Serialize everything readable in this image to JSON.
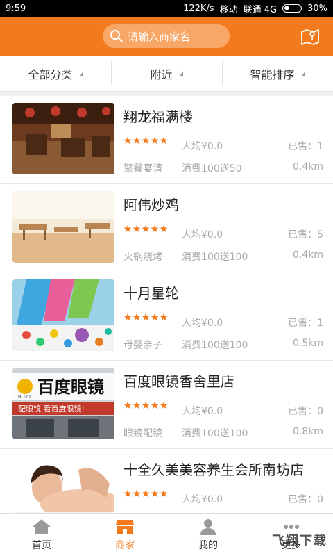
{
  "status": {
    "time": "9:59",
    "network": "122K/s",
    "carrier1": "移动",
    "carrier2": "联通 4G",
    "battery": "30%"
  },
  "search": {
    "placeholder": "请输入商家名"
  },
  "filters": [
    {
      "label": "全部分类"
    },
    {
      "label": "附近"
    },
    {
      "label": "智能排序"
    }
  ],
  "shops": [
    {
      "name": "翔龙福满楼",
      "stars": 5,
      "avg": "人均¥0.0",
      "sold": "已售：1",
      "category": "聚餐宴请",
      "promo": "消费100送50",
      "distance": "0.4km"
    },
    {
      "name": "阿伟炒鸡",
      "stars": 5,
      "avg": "人均¥0.0",
      "sold": "已售：5",
      "category": "火锅烧烤",
      "promo": "消费100送100",
      "distance": "0.4km"
    },
    {
      "name": "十月星轮",
      "stars": 5,
      "avg": "人均¥0.0",
      "sold": "已售：1",
      "category": "母婴亲子",
      "promo": "消费100送100",
      "distance": "0.5km"
    },
    {
      "name": "百度眼镜香舍里店",
      "stars": 5,
      "avg": "人均¥0.0",
      "sold": "已售：0",
      "category": "眼镜配镜",
      "promo": "消费100送100",
      "distance": "0.8km"
    },
    {
      "name": "十全久美美容养生会所南坊店",
      "stars": 5,
      "avg": "人均¥0.0",
      "sold": "已售：0",
      "category": "",
      "promo": "",
      "distance": ""
    }
  ],
  "thumb_text": {
    "glasses_sign": "百度眼镜",
    "glasses_sign_small": "BDYJ",
    "glasses_banner": "配眼镜 看百度眼镜!"
  },
  "tabs": [
    {
      "label": "首页"
    },
    {
      "label": "商家"
    },
    {
      "label": "我的"
    },
    {
      "label": "更多"
    }
  ],
  "watermark": "飞翔下载",
  "colors": {
    "accent": "#f37b1d",
    "star": "#f37b1d"
  }
}
